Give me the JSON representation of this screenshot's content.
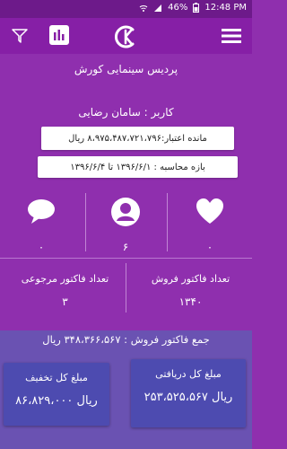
{
  "status_bar": {
    "battery_percent": "46%",
    "time": "12:48 PM",
    "icons": [
      "wifi-icon",
      "signal-icon",
      "battery-icon"
    ]
  },
  "app_bar": {
    "icons": [
      "filter-icon",
      "chart-icon",
      "logo-icon",
      "menu-icon"
    ]
  },
  "page": {
    "title": "پردیس سینمایی کورش",
    "user_line": "کاربر : سامان رضایی"
  },
  "fields": {
    "balance_line": "مانده اعتبار:۸،۹۷۵،۴۸۷،۷۲۱،۷۹۶ ریال",
    "date_range_line": "بازه محاسبه :  ۱۳۹۶/۶/۱   تا  ۱۳۹۶/۶/۴"
  },
  "stats": {
    "left_value": "۰",
    "middle_value": "۶",
    "right_value": "۰",
    "left_icon": "chat-bubble-icon",
    "middle_icon": "user-icon",
    "right_icon": "heart-icon"
  },
  "counts": {
    "returns_label": "تعداد فاکتور مرجوعی",
    "returns_value": "۳",
    "sales_label": "تعداد فاکتور فروش",
    "sales_value": "۱۳۴۰"
  },
  "summary": {
    "total_sales_line": "جمع فاکتور فروش : ۳۴۸،۳۶۶،۵۶۷ ریال"
  },
  "cards": {
    "discount_label": "مبلغ کل تخفیف",
    "discount_value": "۸۶،۸۲۹،۰۰۰ ریال",
    "received_label": "مبلغ کل دریافتی",
    "received_value": "۲۵۳،۵۲۵،۵۶۷ ریال"
  },
  "colors": {
    "background": "#8f2fae",
    "status_bar": "#6d1a8a",
    "header": "#861fa6",
    "bottom_block": "#6a52b2",
    "card": "#4d4bb0"
  }
}
